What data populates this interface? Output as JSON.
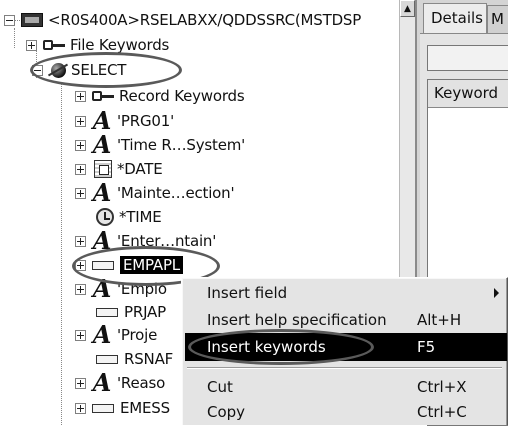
{
  "tree": {
    "root_label": "<R0S400A>RSELABXX/QDDSSRC(MSTDSP",
    "items": [
      {
        "label": "File Keywords",
        "icon": "key-icon"
      },
      {
        "label": "SELECT",
        "icon": "record-format-icon"
      },
      {
        "label": "Record Keywords",
        "icon": "key-icon"
      },
      {
        "label": "'PRG01'",
        "icon": "constant-text-icon"
      },
      {
        "label": "'Time R…System'",
        "icon": "constant-text-icon"
      },
      {
        "label": "*DATE",
        "icon": "date-icon"
      },
      {
        "label": "'Mainte…ection'",
        "icon": "constant-text-icon"
      },
      {
        "label": "*TIME",
        "icon": "clock-icon"
      },
      {
        "label": "'Enter…ntain'",
        "icon": "constant-text-icon"
      },
      {
        "label": "EMPAPL",
        "icon": "field-icon"
      },
      {
        "label": "'Emplo",
        "icon": "constant-text-icon"
      },
      {
        "label": "PRJAP",
        "icon": "field-icon"
      },
      {
        "label": "'Proje",
        "icon": "constant-text-icon"
      },
      {
        "label": "RSNAF",
        "icon": "field-icon"
      },
      {
        "label": "'Reaso",
        "icon": "constant-text-icon"
      },
      {
        "label": "EMESS",
        "icon": "field-icon"
      }
    ]
  },
  "right_pane": {
    "tabs": [
      "Details",
      "M"
    ],
    "table_header": "Keyword"
  },
  "context_menu": {
    "items": [
      {
        "label": "Insert field",
        "shortcut": "",
        "submenu": true
      },
      {
        "label": "Insert help specification",
        "shortcut": "Alt+H"
      },
      {
        "label": "Insert keywords",
        "shortcut": "F5",
        "active": true
      },
      {
        "label": "Cut",
        "shortcut": "Ctrl+X"
      },
      {
        "label": "Copy",
        "shortcut": "Ctrl+C"
      }
    ]
  }
}
